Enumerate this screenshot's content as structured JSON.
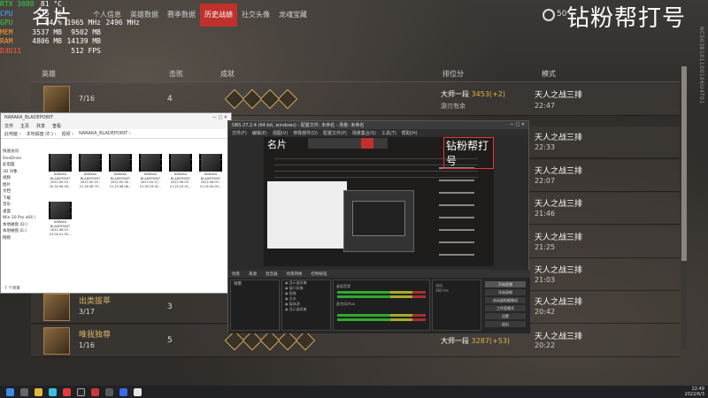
{
  "perf": [
    {
      "label": "RTX 3080",
      "v1": "81",
      "u1": "°C",
      "v2": "",
      "u2": "",
      "cls": "c-gpu"
    },
    {
      "label": "CPU",
      "v1": "75",
      "u1": "°C",
      "v2": "",
      "u2": "",
      "cls": "c-cpu"
    },
    {
      "label": "GPU",
      "v1": "84",
      "u1": "%",
      "v2": "1965",
      "u2": "MHz",
      "v3": "2496",
      "u3": "MHz",
      "cls": "c-gpu"
    },
    {
      "label": "MEM",
      "v1": "3537",
      "u1": "MB",
      "v2": "9502",
      "u2": "MB",
      "cls": "c-mem"
    },
    {
      "label": "RAM",
      "v1": "4806",
      "u1": "MB",
      "v2": "14139",
      "u2": "MB",
      "cls": "c-ram"
    },
    {
      "label": "D3D11",
      "v1": "",
      "u1": "",
      "v2": "512",
      "u2": "FPS",
      "cls": "c-d3d"
    }
  ],
  "game": {
    "title": "名片",
    "tabs": [
      "个人信息",
      "英雄数据",
      "赛季数据",
      "历史战绩",
      "社交头像",
      "龙魂宝藏"
    ],
    "active_tab": "历史战绩",
    "watermark": "钻粉帮打号",
    "coins": "50",
    "side_text": "NC5038101100106U4T01",
    "headers": {
      "hero": "英雄",
      "kills": "击败",
      "achievements": "成就",
      "rank": "排位分",
      "mode": "模式"
    },
    "rows": [
      {
        "name": "",
        "kd": "7/16",
        "kills": "4",
        "rank": "大师一段",
        "pts": "3453(+2)",
        "sub": "游刃有余",
        "mode": "天人之战三排",
        "time": "22:47"
      },
      {
        "name": "出类拔萃",
        "kd": "3/17",
        "kills": "3",
        "rank": "",
        "pts": "",
        "sub": "",
        "mode": "天人之战三排",
        "time": "20:42"
      },
      {
        "name": "唯我独尊",
        "kd": "1/16",
        "kills": "5",
        "rank": "大师一段",
        "pts": "3287(+53)",
        "sub": "",
        "mode": "天人之战三排",
        "time": "20:22"
      }
    ],
    "hidden_rows": [
      {
        "mode": "天人之战三排",
        "time": "22:33"
      },
      {
        "mode": "天人之战三排",
        "time": "22:07"
      },
      {
        "mode": "天人之战三排",
        "time": "21:46"
      },
      {
        "mode": "天人之战三排",
        "time": "21:25"
      },
      {
        "mode": "天人之战三排",
        "time": "21:03"
      }
    ]
  },
  "explorer": {
    "title": "NARAKA_BLADEPOINT",
    "menu": [
      "文件",
      "主页",
      "共享",
      "查看"
    ],
    "path": [
      "此电脑",
      "本地磁盘 (E:)",
      "视频",
      "NARAKA_BLADEPOINT"
    ],
    "side": [
      "快速访问",
      "OneDrive",
      "此电脑",
      "3D 对象",
      "视频",
      "图片",
      "文档",
      "下载",
      "音乐",
      "桌面",
      "Win 10 Pro x64 (",
      "本地磁盘 (D:)",
      "本地磁盘 (E:)",
      "网络"
    ],
    "files": [
      {
        "name": "NARAKA BLADEPOINT",
        "date": "2022.05.20 - 20.34.56.18..."
      },
      {
        "name": "NARAKA BLADEPOINT",
        "date": "2022.05.20 - 21.16.06.75..."
      },
      {
        "name": "NARAKA BLADEPOINT",
        "date": "2022.05.26 - 21.23.48.06..."
      },
      {
        "name": "NARAKA BLADEPOINT",
        "date": "2022.05.27 - 21.30.19.01..."
      },
      {
        "name": "NARAKA BLADEPOINT",
        "date": "2022.06.02 - 21.25.25.01..."
      },
      {
        "name": "NARAKA BLADEPOINT",
        "date": "2022.06.03 - 21.04.04.03..."
      },
      {
        "name": "NARAKA BLADEPOINT",
        "date": "2022.06.03 - 23.04.01.05..."
      }
    ],
    "status": "7 个项目"
  },
  "obs": {
    "title": "OBS 27.2.4 (64-bit, windows) - 配置文件: 未命名 - 场景: 未命名",
    "menu": [
      "文件(F)",
      "编辑(E)",
      "视图(V)",
      "停靠部件(D)",
      "配置文件(P)",
      "场景集合(S)",
      "工具(T)",
      "帮助(H)"
    ],
    "preview_title": "名片",
    "preview_wm": "钻粉帮打号",
    "tabs": [
      "场景",
      "来源",
      "混音器",
      "场景转换",
      "控制按钮"
    ],
    "scene": "场景",
    "sources": [
      "显示器采集",
      "窗口采集",
      "图像",
      "文本",
      "媒体源",
      "显示器采集"
    ],
    "mixer": [
      "桌面音频",
      "麦克风/Aux"
    ],
    "transition": "淡出",
    "duration": "300 ms",
    "controls": [
      "开始直播",
      "开始录制",
      "启动虚拟摄像机",
      "工作室模式",
      "设置",
      "退出"
    ]
  },
  "taskbar": {
    "time": "22:49",
    "date": "2022/6/3"
  }
}
